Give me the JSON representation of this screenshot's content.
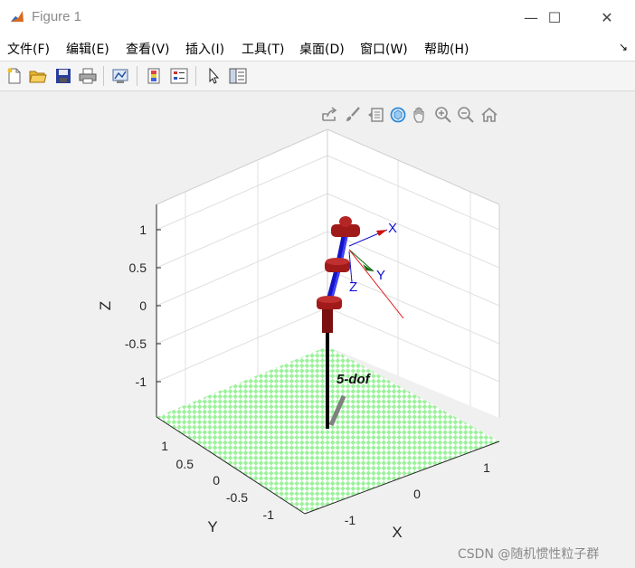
{
  "window": {
    "title": "Figure 1",
    "minimize_glyph": "—",
    "maximize_glyph": "☐",
    "close_glyph": "✕"
  },
  "menubar": {
    "items": [
      {
        "label": "文件(F)"
      },
      {
        "label": "编辑(E)"
      },
      {
        "label": "查看(V)"
      },
      {
        "label": "插入(I)"
      },
      {
        "label": "工具(T)"
      },
      {
        "label": "桌面(D)"
      },
      {
        "label": "窗口(W)"
      },
      {
        "label": "帮助(H)"
      }
    ],
    "dock_arrow": "↘"
  },
  "toolbar": {
    "icons": [
      "new-figure-icon",
      "open-file-icon",
      "save-icon",
      "print-icon",
      "link-plot-icon",
      "colorbar-icon",
      "legend-icon",
      "edit-plot-icon",
      "property-inspector-icon"
    ]
  },
  "axes_toolbar": {
    "icons": [
      "export-icon",
      "brush-icon",
      "datatips-icon",
      "rotate-3d-icon",
      "pan-icon",
      "zoom-in-icon",
      "zoom-out-icon",
      "home-icon"
    ]
  },
  "plot": {
    "x_axis": {
      "label": "X",
      "ticks": [
        "-1",
        "0",
        "1"
      ]
    },
    "y_axis": {
      "label": "Y",
      "ticks": [
        "1",
        "0.5",
        "0",
        "-0.5",
        "-1"
      ]
    },
    "z_axis": {
      "label": "Z",
      "ticks": [
        "1",
        "0.5",
        "0",
        "-0.5",
        "-1"
      ]
    },
    "robot_name": "5-dof",
    "frame_labels": {
      "x": "X",
      "y": "Y",
      "z": "Z"
    },
    "colors": {
      "floor_light": "#9cf29c",
      "floor_grid": "#ffffff",
      "link": "#1515c8",
      "joint": "#a01a1a",
      "base": "#000000",
      "frame_x": "#cc1111",
      "frame_y": "#0a6a0a",
      "frame_z": "#1414c8",
      "shadow": "#808080"
    }
  },
  "watermark": "CSDN @随机惯性粒子群"
}
